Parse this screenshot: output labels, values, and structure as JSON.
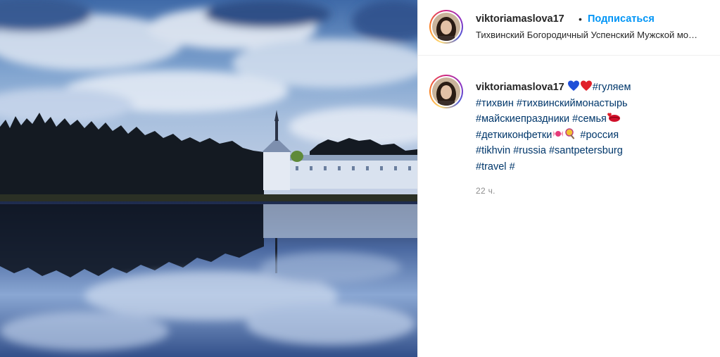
{
  "post": {
    "username": "viktoriamaslova17",
    "separator": "•",
    "follow_label": "Подписаться",
    "location": "Тихвинский Богородичный Успенский Мужской монастырь"
  },
  "caption": {
    "username": "viktoriamaslova17",
    "emoji_1": "blue-heart-icon",
    "emoji_2": "red-heart-icon",
    "tags": {
      "t1": "#гуляем",
      "t2": "#тихвин",
      "t3": "#тихвинскиймонастырь",
      "t4": "#майскиепраздники",
      "t5": "#семья",
      "t6": "#деткиконфетки",
      "t7": "#россия",
      "t8": "#tikhvin",
      "t9": "#russia",
      "t10": "#santpetersburg",
      "t11": "#travel",
      "t12": "#"
    },
    "timestamp": "22 ч."
  },
  "colors": {
    "link": "#00376b",
    "follow": "#0095f6",
    "muted": "#8e8e8e"
  }
}
